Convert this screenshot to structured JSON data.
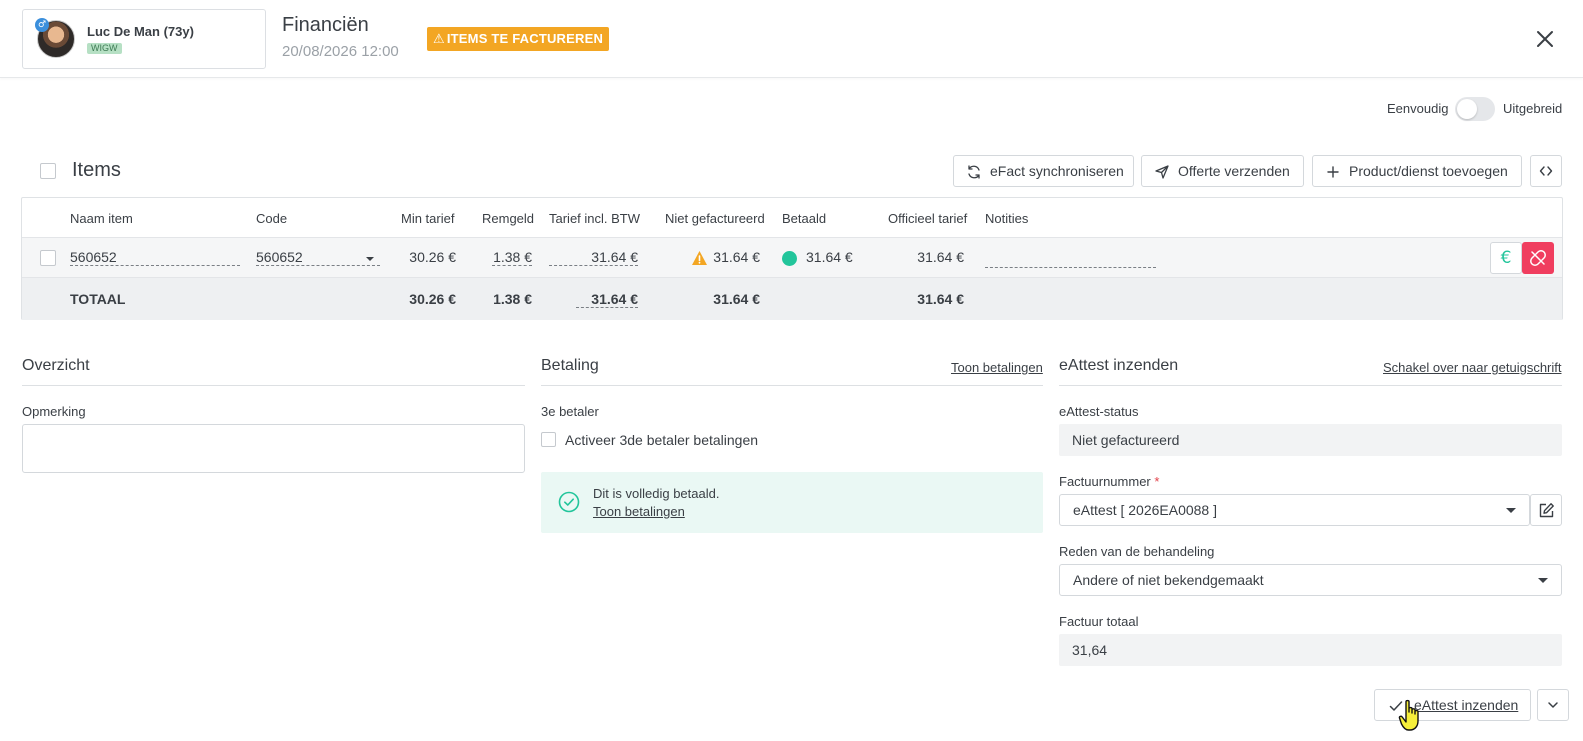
{
  "patient": {
    "name": "Luc De Man (73y)",
    "tag": "WIGW",
    "gender_symbol": "♂"
  },
  "header": {
    "title": "Financiën",
    "datetime": "20/08/2026 12:00",
    "badge": "ITEMS TE FACTUREREN",
    "badge_color": "#f3a623"
  },
  "view_mode": {
    "left_label": "Eenvoudig",
    "right_label": "Uitgebreid",
    "extended_on": false
  },
  "items": {
    "title": "Items",
    "buttons": {
      "sync": "eFact synchroniseren",
      "quote": "Offerte verzenden",
      "add": "Product/dienst toevoegen"
    },
    "columns": [
      "Naam item",
      "Code",
      "Min tarief",
      "Remgeld",
      "Tarief incl. BTW",
      "Niet gefactureerd",
      "Betaald",
      "Officieel tarief",
      "Notities"
    ],
    "row": {
      "name": "560652",
      "code": "560652",
      "min_tarief": "30.26 €",
      "remgeld": "1.38 €",
      "tarief_btw": "31.64 €",
      "niet_gefactureerd": "31.64 €",
      "betaald": "31.64 €",
      "officieel": "31.64 €",
      "notities": ""
    },
    "total": {
      "label": "TOTAAL",
      "min_tarief": "30.26 €",
      "remgeld": "1.38 €",
      "tarief_btw": "31.64 €",
      "niet_gefactureerd": "31.64 €",
      "officieel": "31.64 €"
    }
  },
  "overzicht": {
    "title": "Overzicht",
    "remark_label": "Opmerking",
    "remark_value": ""
  },
  "betaling": {
    "title": "Betaling",
    "link": "Toon betalingen",
    "third_payer_label": "3e betaler",
    "third_payer_checkbox": "Activeer 3de betaler betalingen",
    "paid_message": "Dit is volledig betaald.",
    "paid_link": "Toon betalingen"
  },
  "eattest": {
    "title": "eAttest inzenden",
    "switch_link": "Schakel over naar getuigschrift",
    "status_label": "eAttest-status",
    "status_value": "Niet gefactureerd",
    "invoice_label": "Factuurnummer",
    "invoice_required": "*",
    "invoice_value": "eAttest [ 2026EA0088 ]",
    "reason_label": "Reden van de behandeling",
    "reason_value": "Andere of niet bekendgemaakt",
    "total_label": "Factuur totaal",
    "total_value": "31,64",
    "submit_label": "eAttest inzenden"
  },
  "colors": {
    "accent_green": "#22c59b",
    "danger": "#f03e5f",
    "warning": "#f3a623"
  }
}
